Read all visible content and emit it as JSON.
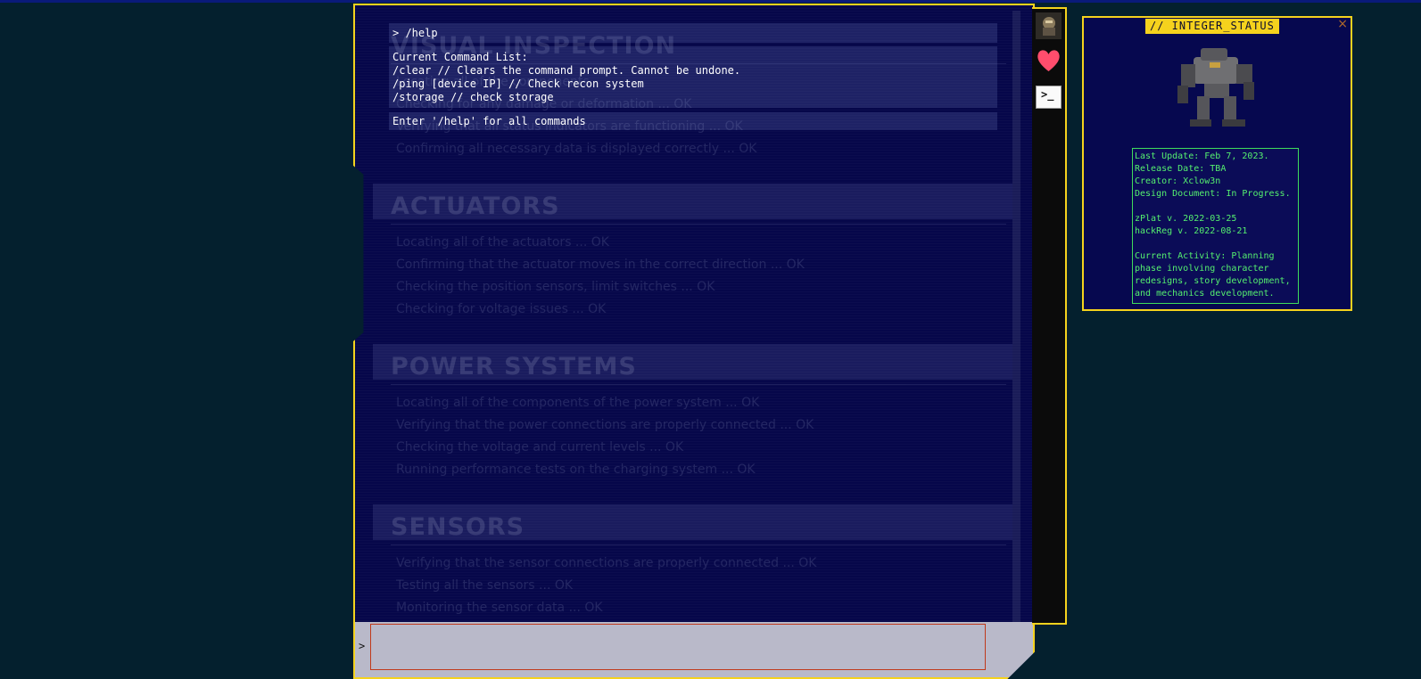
{
  "terminal": {
    "echo": "> /help",
    "help_lines": [
      "Current Command List:",
      "/clear // Clears the command prompt. Cannot be undone.",
      "/ping [device IP] // Check recon system",
      "/storage // check storage"
    ],
    "hint": "Enter '/help' for all commands",
    "prompt": ">",
    "input_value": ""
  },
  "background_sections": [
    {
      "title": "VISUAL INSPECTION",
      "lines": [
        "Locating all of the components",
        "Checking for any damage or deformation ... OK",
        "Verifying that all status indicators are functioning ... OK",
        "Confirming all necessary data is displayed correctly ... OK"
      ]
    },
    {
      "title": "ACTUATORS",
      "lines": [
        "Locating all of the actuators ... OK",
        "Confirming that the actuator moves in the correct direction ... OK",
        "Checking the position sensors, limit switches ... OK",
        "Checking for voltage issues ... OK"
      ]
    },
    {
      "title": "POWER SYSTEMS",
      "lines": [
        "Locating all of the components of the power system ... OK",
        "Verifying that the power connections are properly connected ... OK",
        "Checking the voltage and current levels ... OK",
        "Running performance tests on the charging system ... OK"
      ]
    },
    {
      "title": "SENSORS",
      "lines": [
        "Verifying that the sensor connections are properly connected ... OK",
        "Testing all the sensors ... OK",
        "Monitoring the sensor data ... OK"
      ]
    }
  ],
  "dock": {
    "items": [
      "avatar-icon",
      "heart-icon",
      "terminal-icon"
    ],
    "terminal_glyph": ">_",
    "heart_color": "#ff4d6d"
  },
  "status": {
    "title": "// INTEGER_STATUS",
    "close": "×",
    "info_lines": [
      "Last Update: Feb 7, 2023.",
      "Release Date: TBA",
      "Creator: Xclow3n",
      "Design Document: In Progress."
    ],
    "version_lines": [
      "zPlat v. 2022-03-25",
      "hackReg v. 2022-08-21"
    ],
    "activity_lines": [
      "Current Activity: Planning",
      "phase involving character",
      "redesigns, story development,",
      "and mechanics development."
    ]
  },
  "colors": {
    "accent": "#f5d21d",
    "terminal_bg": "#06074a",
    "info_text": "#55f06f",
    "input_border": "#c0391b"
  }
}
